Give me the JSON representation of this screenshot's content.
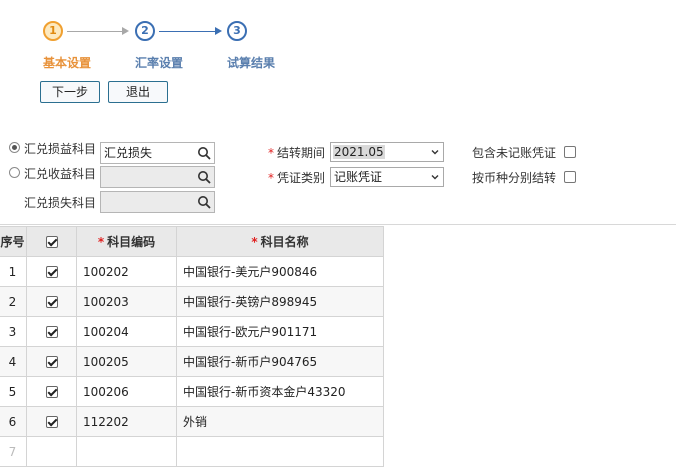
{
  "wizard": {
    "steps": [
      {
        "number": "1",
        "label": "基本设置",
        "state": "active"
      },
      {
        "number": "2",
        "label": "汇率设置",
        "state": "inactive"
      },
      {
        "number": "3",
        "label": "试算结果",
        "state": "inactive"
      }
    ]
  },
  "actions": {
    "next_label": "下一步",
    "exit_label": "退出"
  },
  "form": {
    "radio_exchange_loss_gain": {
      "label": "汇兑损益科目",
      "checked": true,
      "value": "汇兑损失"
    },
    "radio_exchange_gain": {
      "label": "汇兑收益科目",
      "checked": false,
      "value": ""
    },
    "exchange_loss": {
      "label": "汇兑损失科目",
      "value": ""
    },
    "period": {
      "required_mark": "*",
      "label": "结转期间",
      "value": "2021.05"
    },
    "voucher_type": {
      "required_mark": "*",
      "label": "凭证类别",
      "value": "记账凭证"
    },
    "include_unposted": {
      "label": "包含未记账凭证",
      "checked": false
    },
    "by_currency": {
      "label": "按币种分别结转",
      "checked": false
    }
  },
  "table": {
    "headers": {
      "index": "序号",
      "code_required": "*",
      "code": "科目编码",
      "name_required": "*",
      "name": "科目名称"
    },
    "header_checked": true,
    "rows": [
      {
        "index": "1",
        "checked": true,
        "code": "100202",
        "name": "中国银行-美元户900846"
      },
      {
        "index": "2",
        "checked": true,
        "code": "100203",
        "name": "中国银行-英镑户898945"
      },
      {
        "index": "3",
        "checked": true,
        "code": "100204",
        "name": "中国银行-欧元户901171"
      },
      {
        "index": "4",
        "checked": true,
        "code": "100205",
        "name": "中国银行-新币户904765"
      },
      {
        "index": "5",
        "checked": true,
        "code": "100206",
        "name": "中国银行-新币资本金户43320"
      },
      {
        "index": "6",
        "checked": true,
        "code": "112202",
        "name": "外销"
      },
      {
        "index": "7",
        "checked": false,
        "code": "",
        "name": ""
      }
    ]
  },
  "colors": {
    "active_step": "#f0a030",
    "inactive_step": "#3b6fb3",
    "required": "#e02020"
  }
}
